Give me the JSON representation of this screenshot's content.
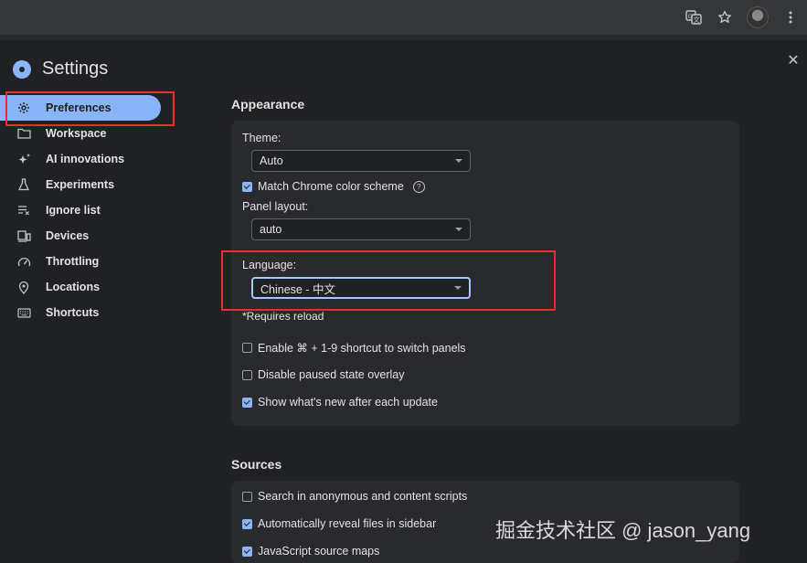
{
  "settings": {
    "title": "Settings"
  },
  "sidebar": {
    "items": [
      {
        "label": "Preferences",
        "icon": "gear-icon"
      },
      {
        "label": "Workspace",
        "icon": "folder-icon"
      },
      {
        "label": "AI innovations",
        "icon": "sparkle-icon"
      },
      {
        "label": "Experiments",
        "icon": "flask-icon"
      },
      {
        "label": "Ignore list",
        "icon": "ignore-list-icon"
      },
      {
        "label": "Devices",
        "icon": "devices-icon"
      },
      {
        "label": "Throttling",
        "icon": "gauge-icon"
      },
      {
        "label": "Locations",
        "icon": "location-pin-icon"
      },
      {
        "label": "Shortcuts",
        "icon": "keyboard-icon"
      }
    ]
  },
  "appearance": {
    "title": "Appearance",
    "theme_label": "Theme:",
    "theme_value": "Auto",
    "match_scheme": "Match Chrome color scheme",
    "panel_layout_label": "Panel layout:",
    "panel_layout_value": "auto",
    "language_label": "Language:",
    "language_value": "Chinese - 中文",
    "requires_reload": "*Requires reload",
    "enable_shortcut": "Enable ⌘ + 1-9 shortcut to switch panels",
    "disable_paused": "Disable paused state overlay",
    "show_whats_new": "Show what's new after each update"
  },
  "sources": {
    "title": "Sources",
    "search_anon": "Search in anonymous and content scripts",
    "auto_reveal": "Automatically reveal files in sidebar",
    "js_source_maps": "JavaScript source maps"
  },
  "watermark": "掘金技术社区 @ jason_yang",
  "colors": {
    "accent": "#8ab4f8",
    "highlight_box": "#e8302b",
    "background": "#202124",
    "card": "#292a2d"
  }
}
